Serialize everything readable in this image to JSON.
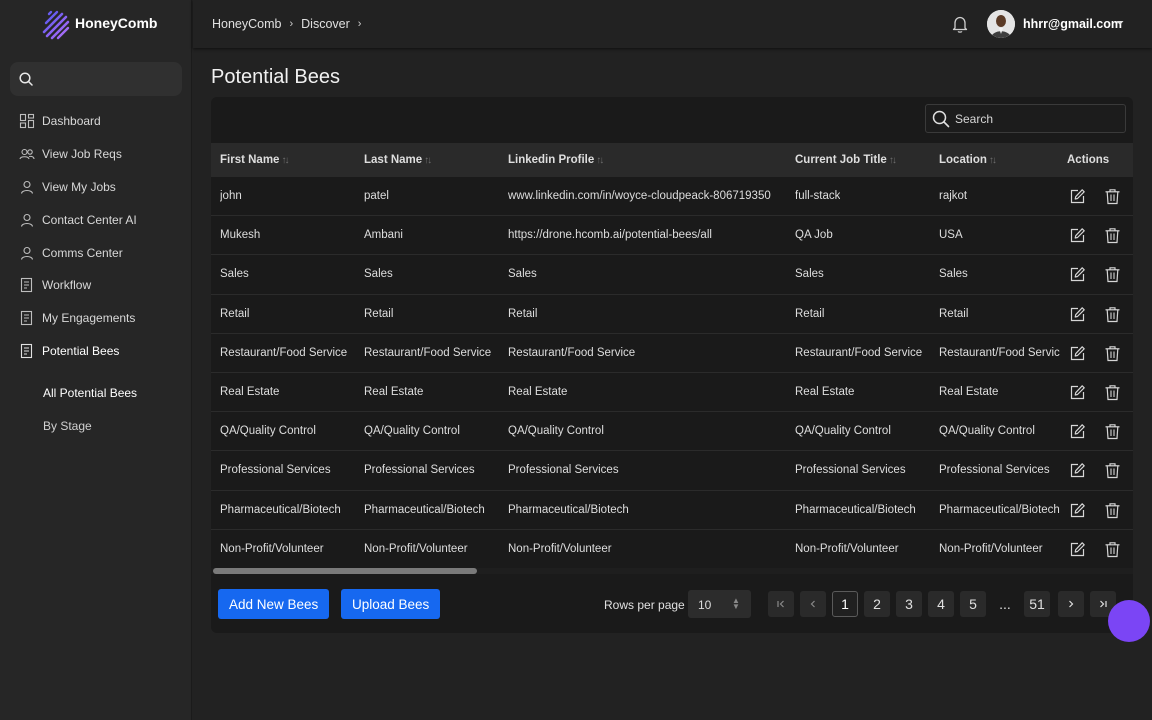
{
  "app": {
    "name": "HoneyComb"
  },
  "sidebar": {
    "search_icon": "search-icon",
    "items": [
      {
        "label": "Dashboard",
        "icon": "dashboard-icon"
      },
      {
        "label": "View Job Reqs",
        "icon": "users-icon"
      },
      {
        "label": "View My Jobs",
        "icon": "user-icon"
      },
      {
        "label": "Contact Center AI",
        "icon": "user-icon"
      },
      {
        "label": "Comms Center",
        "icon": "user-icon"
      },
      {
        "label": "Workflow",
        "icon": "document-icon"
      },
      {
        "label": "My Engagements",
        "icon": "document-icon"
      },
      {
        "label": "Potential Bees",
        "icon": "document-icon",
        "active": true
      }
    ],
    "sub_items": [
      {
        "label": "All Potential Bees",
        "active": true
      },
      {
        "label": "By Stage"
      }
    ]
  },
  "header": {
    "breadcrumb": [
      "HoneyComb",
      "Discover"
    ],
    "user_email": "hhrr@gmail.com"
  },
  "main": {
    "title": "Potential Bees",
    "search": {
      "placeholder": "Search"
    },
    "table": {
      "columns": [
        "First Name",
        "Last Name",
        "Linkedin Profile",
        "Current Job Title",
        "Location",
        "Actions"
      ],
      "rows": [
        [
          "john",
          "patel",
          "www.linkedin.com/in/woyce-cloudpeack-806719350",
          "full-stack",
          "rajkot"
        ],
        [
          "Mukesh",
          "Ambani",
          "https://drone.hcomb.ai/potential-bees/all",
          "QA Job",
          "USA"
        ],
        [
          "Sales",
          "Sales",
          "Sales",
          "Sales",
          "Sales"
        ],
        [
          "Retail",
          "Retail",
          "Retail",
          "Retail",
          "Retail"
        ],
        [
          "Restaurant/Food Service",
          "Restaurant/Food Service",
          "Restaurant/Food Service",
          "Restaurant/Food Service",
          "Restaurant/Food Service"
        ],
        [
          "Real Estate",
          "Real Estate",
          "Real Estate",
          "Real Estate",
          "Real Estate"
        ],
        [
          "QA/Quality Control",
          "QA/Quality Control",
          "QA/Quality Control",
          "QA/Quality Control",
          "QA/Quality Control"
        ],
        [
          "Professional Services",
          "Professional Services",
          "Professional Services",
          "Professional Services",
          "Professional Services"
        ],
        [
          "Pharmaceutical/Biotech",
          "Pharmaceutical/Biotech",
          "Pharmaceutical/Biotech",
          "Pharmaceutical/Biotech",
          "Pharmaceutical/Biotech"
        ],
        [
          "Non-Profit/Volunteer",
          "Non-Profit/Volunteer",
          "Non-Profit/Volunteer",
          "Non-Profit/Volunteer",
          "Non-Profit/Volunteer"
        ]
      ]
    },
    "buttons": {
      "add": "Add New Bees",
      "upload": "Upload Bees"
    },
    "pagination": {
      "rows_label": "Rows per page",
      "rows_value": "10",
      "pages": [
        "1",
        "2",
        "3",
        "4",
        "5",
        "...",
        "51"
      ],
      "current": "1"
    }
  },
  "colors": {
    "accent": "#1668f0",
    "fab": "#7b45f5",
    "background": "#222222"
  }
}
